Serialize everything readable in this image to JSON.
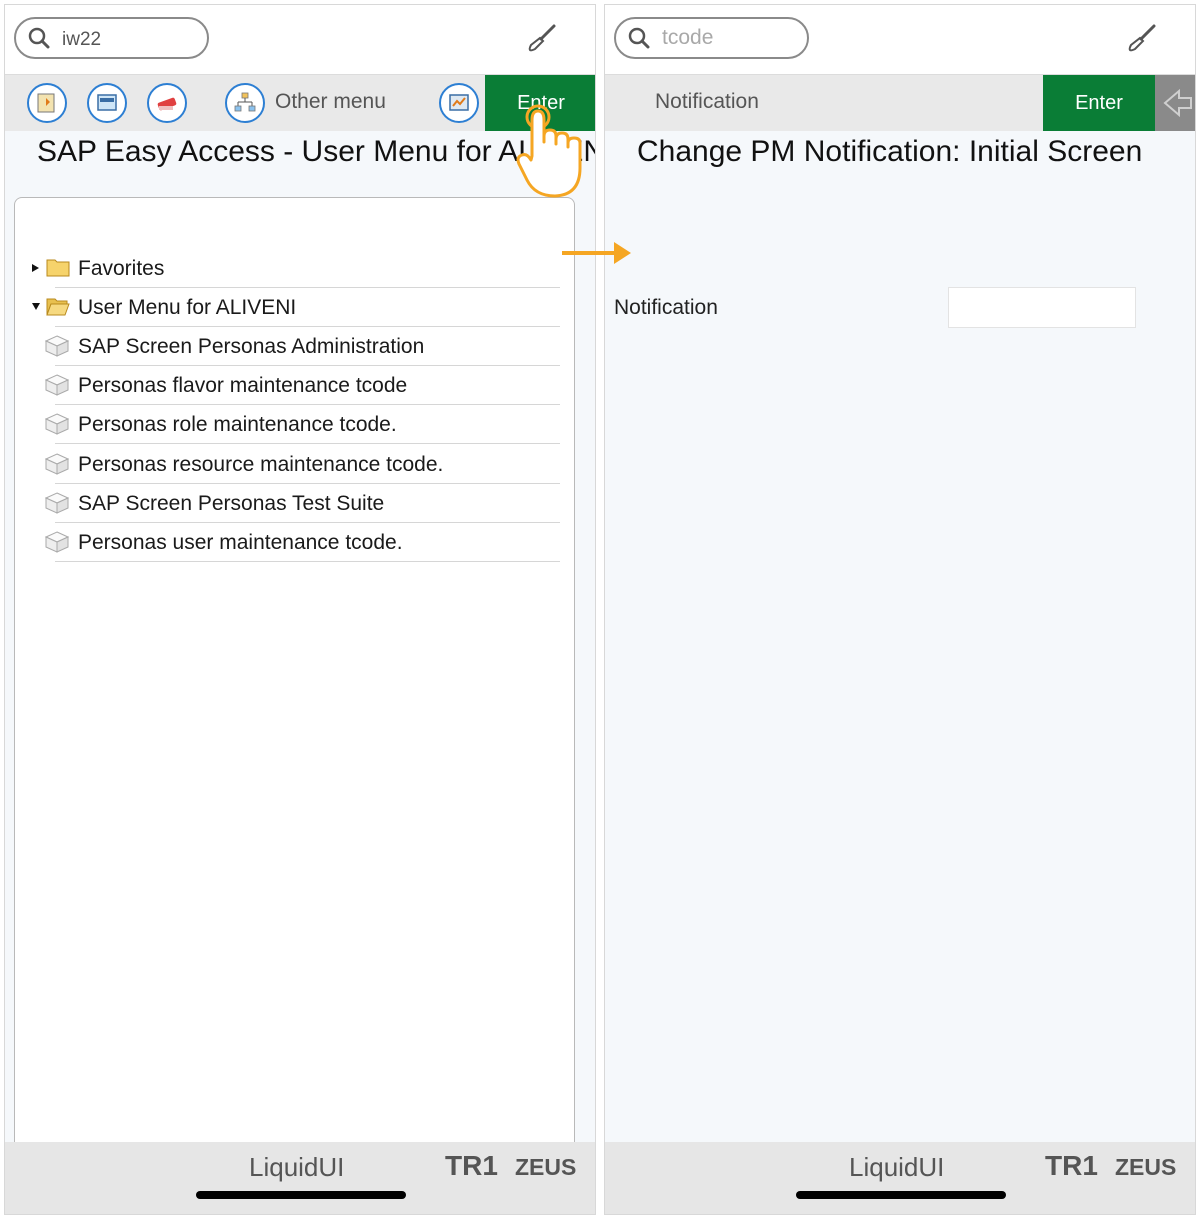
{
  "left_screen": {
    "search": {
      "value": "iw22"
    },
    "toolbar": {
      "other_menu_label": "Other menu",
      "enter_label": "Enter"
    },
    "title": "SAP Easy Access  -  User Menu for ALIVENI",
    "tree": [
      {
        "label": "Favorites",
        "type": "folder",
        "expanded": false
      },
      {
        "label": "User Menu for ALIVENI",
        "type": "folder",
        "expanded": true
      },
      {
        "label": "SAP Screen Personas Administration",
        "type": "transaction"
      },
      {
        "label": "Personas flavor maintenance tcode",
        "type": "transaction"
      },
      {
        "label": "Personas role maintenance tcode.",
        "type": "transaction"
      },
      {
        "label": "Personas resource maintenance tcode.",
        "type": "transaction"
      },
      {
        "label": "SAP Screen Personas Test Suite",
        "type": "transaction"
      },
      {
        "label": "Personas user maintenance tcode.",
        "type": "transaction"
      }
    ],
    "footer": {
      "brand": "LiquidUI",
      "system": "TR1",
      "server": "ZEUS"
    }
  },
  "right_screen": {
    "search": {
      "placeholder": "tcode"
    },
    "toolbar": {
      "tab_label": "Notification",
      "enter_label": "Enter"
    },
    "title": "Change PM Notification: Initial Screen",
    "form": {
      "notification_label": "Notification",
      "notification_value": ""
    },
    "footer": {
      "brand": "LiquidUI",
      "system": "TR1",
      "server": "ZEUS"
    }
  },
  "colors": {
    "enter_green": "#0a7d36",
    "accent_orange": "#f5a623",
    "icon_blue": "#2d7fd3"
  },
  "icons": [
    "search-icon",
    "paintbrush-icon",
    "favorites-icon",
    "easy-access-icon",
    "delete-favorite-icon",
    "other-menu-icon",
    "display-icon",
    "back-icon",
    "folder-icon",
    "transaction-cube-icon",
    "tap-hand-icon",
    "flow-arrow-icon"
  ]
}
